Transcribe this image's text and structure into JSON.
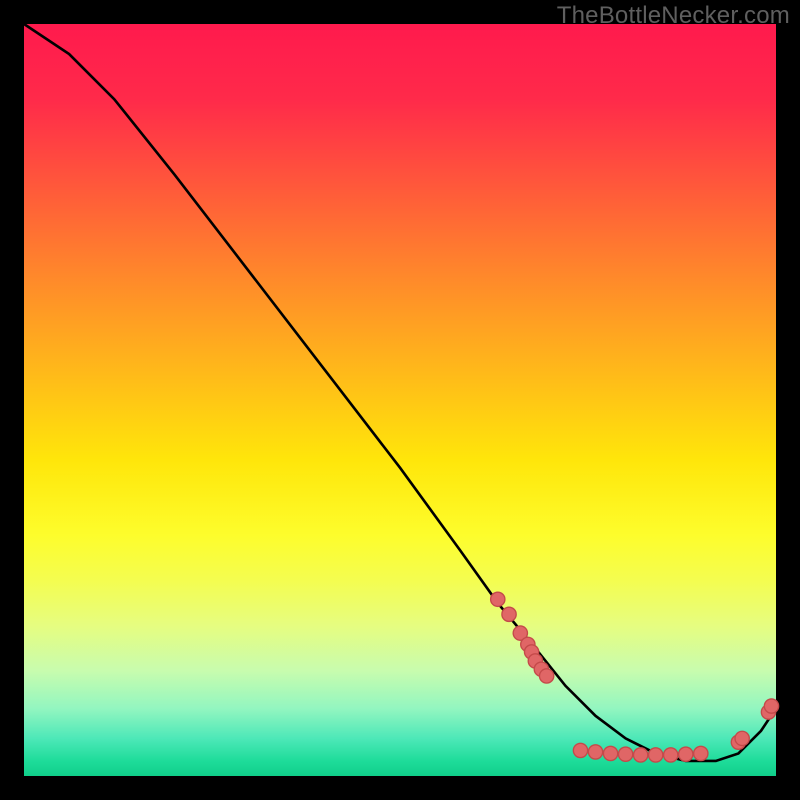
{
  "watermark": "TheBottleNecker.com",
  "colors": {
    "frame_bg": "#000000",
    "watermark": "#5f5f5f",
    "curve": "#000000",
    "dot_fill": "#e06666",
    "dot_stroke": "#c44a4a"
  },
  "chart_data": {
    "type": "line",
    "title": "",
    "xlabel": "",
    "ylabel": "",
    "xlim": [
      0,
      100
    ],
    "ylim": [
      0,
      100
    ],
    "x": [
      0,
      6,
      12,
      20,
      30,
      40,
      50,
      58,
      63,
      68,
      72,
      76,
      80,
      84,
      88,
      92,
      95,
      98,
      100
    ],
    "values": [
      100,
      96,
      90,
      80,
      67,
      54,
      41,
      30,
      23,
      17,
      12,
      8,
      5,
      3,
      2,
      2,
      3,
      6,
      9
    ],
    "overlay_points": {
      "x": [
        63,
        64.5,
        66,
        67,
        67.5,
        68,
        68.8,
        69.5,
        74,
        76,
        78,
        80,
        82,
        84,
        86,
        88,
        90,
        95,
        95.5,
        99,
        99.4
      ],
      "y": [
        23.5,
        21.5,
        19,
        17.5,
        16.5,
        15.3,
        14.2,
        13.3,
        3.4,
        3.2,
        3.0,
        2.9,
        2.8,
        2.8,
        2.8,
        2.9,
        3.0,
        4.5,
        5.0,
        8.5,
        9.3
      ]
    }
  }
}
